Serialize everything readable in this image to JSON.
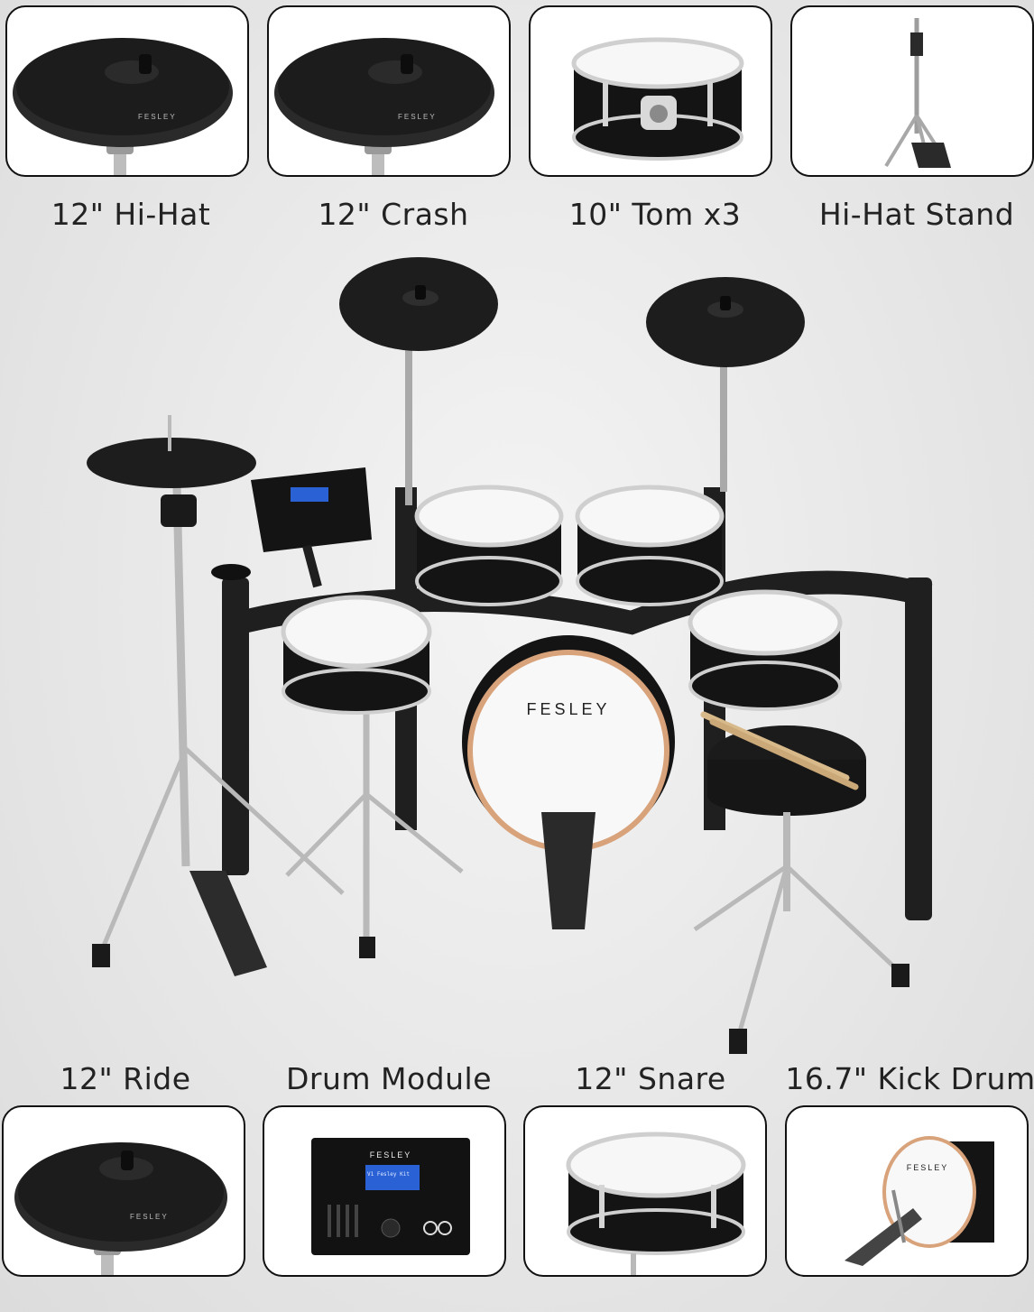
{
  "brand": "FESLEY",
  "module_screen": "V1 Fesley Kit",
  "colors": {
    "tile_border": "#111111",
    "cymbal": "#1e1e1e",
    "drum_shell": "#151515",
    "chrome": "#c8c8c8",
    "drum_head": "#f7f7f7",
    "screen": "#2a62d6"
  },
  "components_top": [
    {
      "label": "12\" Hi-Hat",
      "icon": "hihat-cymbal-icon"
    },
    {
      "label": "12\" Crash",
      "icon": "crash-cymbal-icon"
    },
    {
      "label": "10\" Tom x3",
      "icon": "tom-drum-icon"
    },
    {
      "label": "Hi-Hat Stand",
      "icon": "hihat-stand-icon"
    }
  ],
  "components_bottom": [
    {
      "label": "12\" Ride",
      "icon": "ride-cymbal-icon"
    },
    {
      "label": "Drum Module",
      "icon": "drum-module-icon"
    },
    {
      "label": "12\" Snare",
      "icon": "snare-drum-icon"
    },
    {
      "label": "16.7\" Kick Drum",
      "icon": "kick-drum-icon"
    }
  ]
}
